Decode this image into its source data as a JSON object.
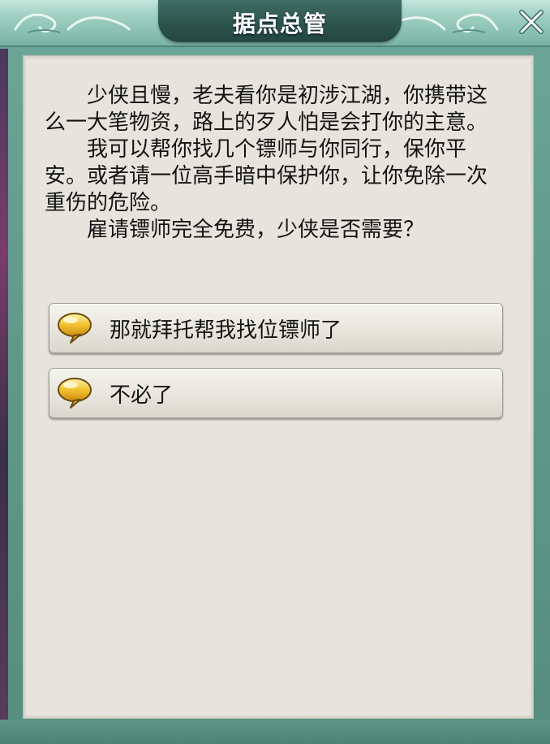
{
  "dialog": {
    "title": "据点总管",
    "paragraphs": [
      "少侠且慢，老夫看你是初涉江湖，你携带这么一大笔物资，路上的歹人怕是会打你的主意。",
      "我可以帮你找几个镖师与你同行，保你平安。或者请一位高手暗中保护你，让你免除一次重伤的危险。",
      "雇请镖师完全免费，少侠是否需要？"
    ],
    "options": [
      {
        "label": "那就拜托帮我找位镖师了",
        "icon": "speech-bubble-icon"
      },
      {
        "label": "不必了",
        "icon": "speech-bubble-icon"
      }
    ]
  },
  "colors": {
    "frame": "#6ba595",
    "title_plate": "#2c534b",
    "panel": "#e6e4dc",
    "bubble": "#f2c230"
  },
  "close_icon": "close-icon"
}
